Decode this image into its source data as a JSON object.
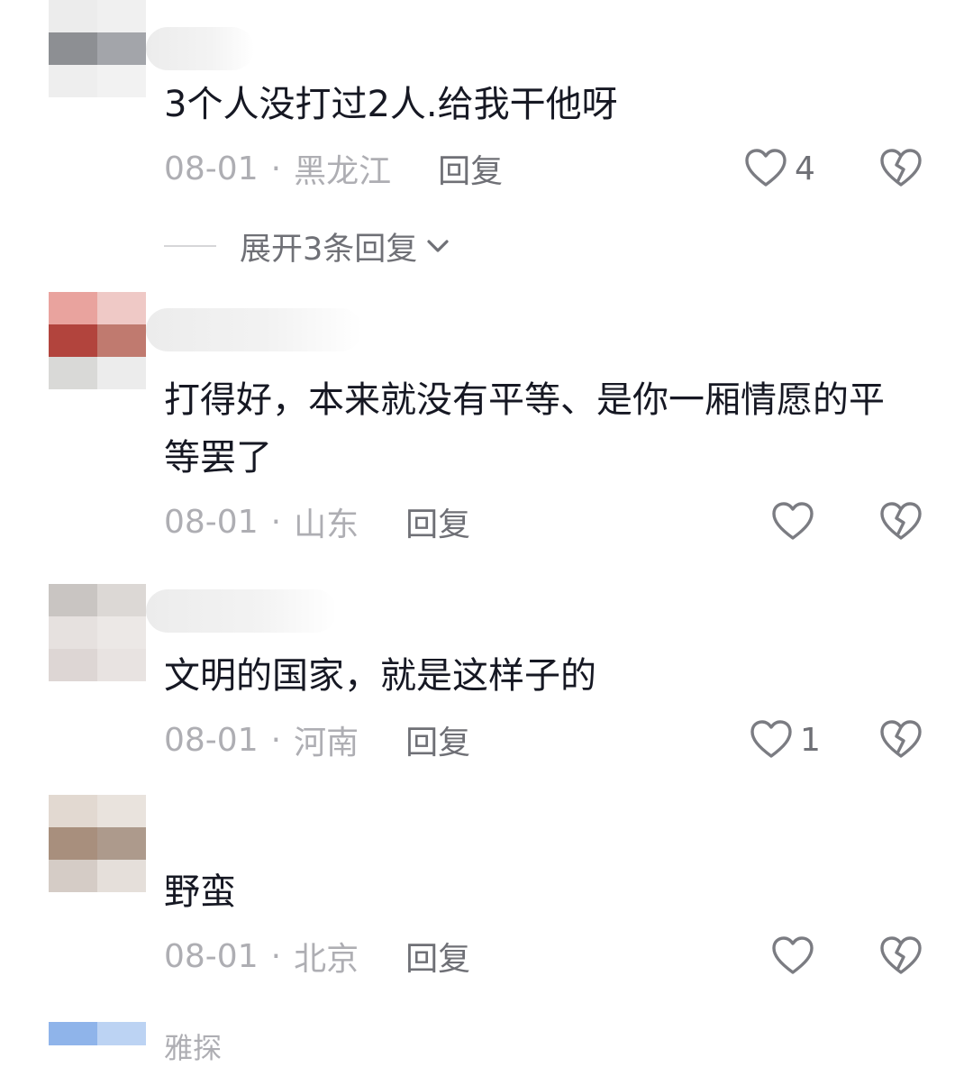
{
  "comments": [
    {
      "text": "3个人没打过2人.给我干他呀",
      "date": "08-01",
      "separator": "·",
      "location": "黑龙江",
      "reply": "回复",
      "likes": "4",
      "expand": "展开3条回复"
    },
    {
      "text": "打得好，本来就没有平等、是你一厢情愿的平等罢了",
      "date": "08-01",
      "separator": "·",
      "location": "山东",
      "reply": "回复",
      "likes": ""
    },
    {
      "text": "文明的国家，就是这样子的",
      "date": "08-01",
      "separator": "·",
      "location": "河南",
      "reply": "回复",
      "likes": "1"
    },
    {
      "text": "野蛮",
      "date": "08-01",
      "separator": "·",
      "location": "北京",
      "reply": "回复",
      "likes": ""
    }
  ],
  "peek": {
    "name": "雅探"
  },
  "icons": {
    "like": "heart-outline-icon",
    "dislike": "broken-heart-icon",
    "expand": "chevron-down-icon"
  },
  "colors": {
    "primary_text": "#161823",
    "secondary_text": "#aeaeb3",
    "action_text": "#6f7076",
    "icon_stroke": "#7b7c82"
  }
}
